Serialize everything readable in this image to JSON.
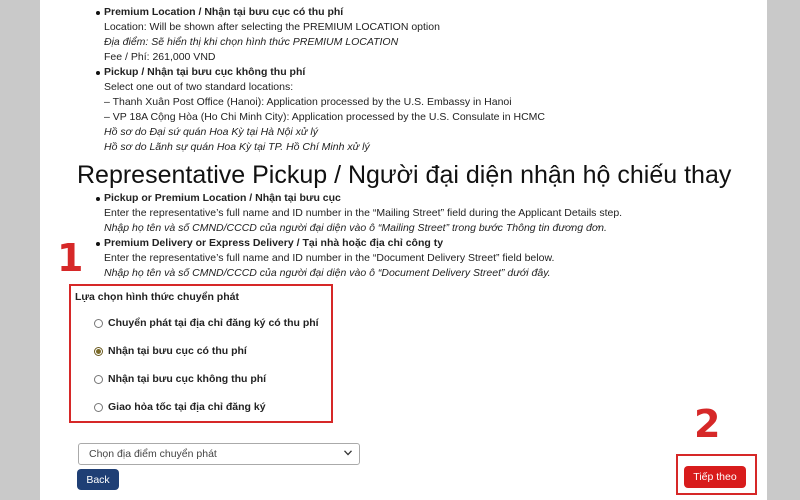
{
  "content": {
    "premium": {
      "title": "Premium Location / Nhận tại bưu cục có thu phí",
      "location_en": "Location: Will be shown after selecting the PREMIUM LOCATION option",
      "location_vi": "Địa điểm: Sẽ hiển thị khi chọn hình thức PREMIUM LOCATION",
      "fee": "Fee / Phí: 261,000 VND"
    },
    "pickup": {
      "title": "Pickup / Nhận tại bưu cục không thu phí",
      "intro": "Select one out of two standard locations:",
      "option1": "– Thanh Xuân Post Office (Hanoi): Application processed by the U.S. Embassy in Hanoi",
      "option2": "– VP 18A Cộng Hòa (Ho Chi Minh City): Application processed by the U.S. Consulate in HCMC",
      "note1": "Hồ sơ do Đại sứ quán Hoa Kỳ tại Hà Nội xử lý",
      "note2": "Hồ sơ do Lãnh sự quán Hoa Kỳ tại TP. Hồ Chí Minh xử lý"
    },
    "representative": {
      "heading": "Representative Pickup / Người đại diện nhận hộ chiếu thay",
      "pickup_title": "Pickup or Premium Location / Nhận tại bưu cục",
      "pickup_en": "Enter the representative’s full name and ID number in the “Mailing Street” field during the Applicant Details step.",
      "pickup_vi": "Nhập họ tên và số CMND/CCCD của người đại diện vào ô “Mailing Street” trong bước Thông tin đương đơn.",
      "delivery_title": "Premium Delivery or Express Delivery / Tại nhà hoặc địa chỉ công ty",
      "delivery_en": "Enter the representative’s full name and ID number in the “Document Delivery Street” field below.",
      "delivery_vi": "Nhập họ tên và số CMND/CCCD của người đại diện vào ô “Document Delivery Street” dưới đây."
    }
  },
  "delivery_form": {
    "label": "Lựa chọn hình thức chuyển phát",
    "options": [
      {
        "label": "Chuyển phát tại địa chỉ đăng ký có thu phí",
        "checked": false
      },
      {
        "label": "Nhận tại bưu cục có thu phí",
        "checked": true
      },
      {
        "label": "Nhận tại bưu cục không thu phí",
        "checked": false
      },
      {
        "label": "Giao hỏa tốc tại địa chỉ đăng ký",
        "checked": false
      }
    ]
  },
  "location_select": {
    "value": "Chọn địa điểm chuyển phát"
  },
  "buttons": {
    "back": "Back",
    "next": "Tiếp theo"
  },
  "markers": {
    "one": "1",
    "two": "2"
  },
  "colors": {
    "highlight": "#d62828",
    "back_button": "#1f3f75",
    "next_button": "#d81c1c"
  }
}
